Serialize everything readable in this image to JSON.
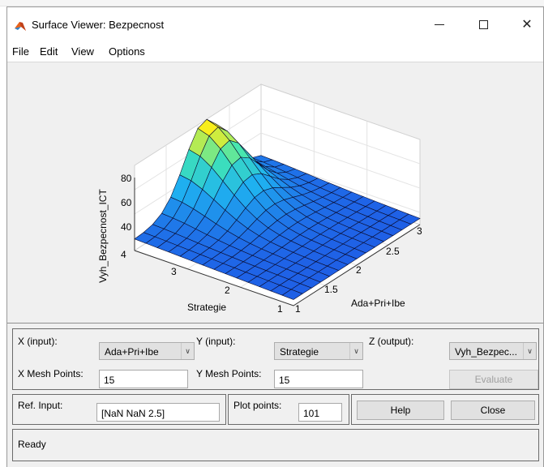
{
  "window": {
    "title": "Surface Viewer: Bezpecnost",
    "minimize_glyph": "—",
    "close_glyph": "✕"
  },
  "menu": [
    "File",
    "Edit",
    "View",
    "Options"
  ],
  "plot": {
    "z_label": "Vyh_Bezpecnost_ICT",
    "x_label": "Ada+Pri+Ibe",
    "y_label": "Strategie",
    "z_ticks": [
      "80",
      "60",
      "40"
    ],
    "x_ticks": [
      "1",
      "1.5",
      "2",
      "2.5",
      "3"
    ],
    "y_ticks": [
      "4",
      "3",
      "2",
      "1"
    ]
  },
  "controls": {
    "x_input_label": "X (input):",
    "x_input_value": "Ada+Pri+Ibe",
    "y_input_label": "Y (input):",
    "y_input_value": "Strategie",
    "z_output_label": "Z (output):",
    "z_output_value": "Vyh_Bezpec...",
    "x_mesh_label": "X Mesh Points:",
    "x_mesh_value": "15",
    "y_mesh_label": "Y Mesh Points:",
    "y_mesh_value": "15",
    "evaluate_label": "Evaluate",
    "ref_input_label": "Ref. Input:",
    "ref_input_value": "[NaN NaN 2.5]",
    "plot_points_label": "Plot points:",
    "plot_points_value": "101",
    "help_label": "Help",
    "close_label": "Close"
  },
  "status": {
    "text": "Ready"
  },
  "colors": {
    "surface_low": "#1f5fe6",
    "surface_mid": "#1fb2f0",
    "surface_high": "#41e6b4",
    "surface_peak": "#f8ee1c"
  }
}
